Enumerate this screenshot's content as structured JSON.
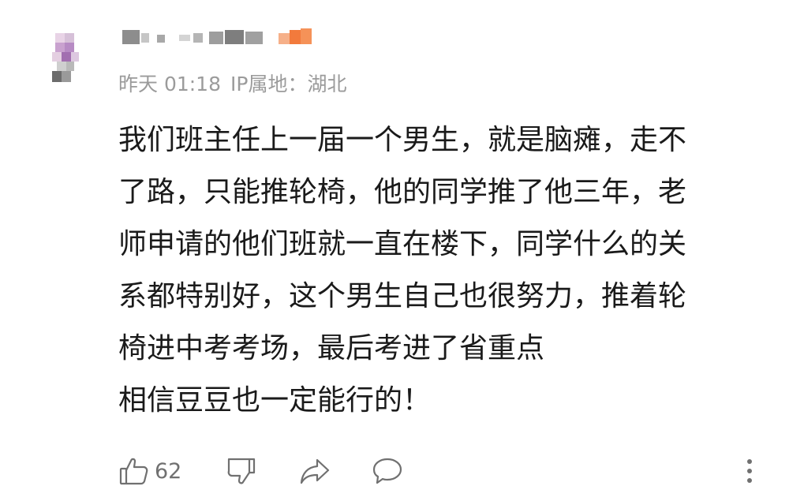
{
  "comment": {
    "meta": {
      "time": "昨天 01:18",
      "ip_label": "IP属地：湖北"
    },
    "content_lines": [
      "我们班主任上一届一个男生，就是脑瘫，走不",
      "了路，只能推轮椅，他的同学推了他三年，老",
      "师申请的他们班就一直在楼下，同学什么的关",
      "系都特别好，这个男生自己也很努力，推着轮",
      "椅进中考考场，最后考进了省重点",
      "相信豆豆也一定能行的！"
    ],
    "actions": {
      "like_count": "62",
      "icons": [
        "thumbs-up-icon",
        "thumbs-down-icon",
        "share-icon",
        "reply-icon",
        "more-icon"
      ]
    },
    "colors": {
      "meta_text": "#9b9b9b",
      "body_text": "#1a1a1a",
      "action_icon": "#707070",
      "badge": "#f27a3c"
    }
  }
}
